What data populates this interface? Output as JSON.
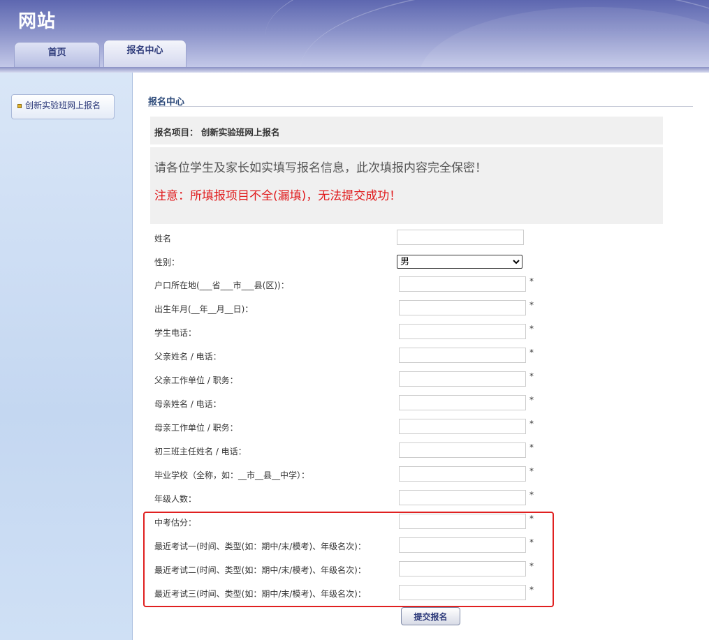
{
  "site": {
    "title": "网站"
  },
  "tabs": [
    {
      "label": "首页"
    },
    {
      "label": "报名中心"
    }
  ],
  "sidebar": {
    "items": [
      {
        "label": "创新实验班网上报名"
      }
    ]
  },
  "main": {
    "section_title": "报名中心",
    "project_label": "报名项目：  创新实验班网上报名",
    "notice_line1": "请各位学生及家长如实填写报名信息，此次填报内容完全保密！",
    "notice_line2": "注意：所填报项目不全(漏填)，无法提交成功！",
    "notice_line2_color": "#e0191b"
  },
  "form": {
    "name_label": "姓名",
    "name_value": "",
    "gender_label": "性别：",
    "gender_selected": "男",
    "required_mark": "*",
    "fields": [
      {
        "label": "户口所在地(___省___市___县(区))：",
        "value": ""
      },
      {
        "label": "出生年月(__年__月__日)：",
        "value": ""
      },
      {
        "label": "学生电话：",
        "value": ""
      },
      {
        "label": "父亲姓名 / 电话：",
        "value": ""
      },
      {
        "label": "父亲工作单位 / 职务：",
        "value": ""
      },
      {
        "label": "母亲姓名 / 电话：",
        "value": ""
      },
      {
        "label": "母亲工作单位 / 职务：",
        "value": ""
      },
      {
        "label": "初三班主任姓名 / 电话：",
        "value": ""
      },
      {
        "label": "毕业学校（全称，如：__市__县__中学）：",
        "value": ""
      },
      {
        "label": "年级人数：",
        "value": ""
      },
      {
        "label": "中考估分：",
        "value": ""
      },
      {
        "label": "最近考试一(时间、类型(如：期中/末/模考)、年级名次)：",
        "value": ""
      },
      {
        "label": "最近考试二(时间、类型(如：期中/末/模考)、年级名次)：",
        "value": ""
      },
      {
        "label": "最近考试三(时间、类型(如：期中/末/模考)、年级名次)：",
        "value": ""
      }
    ],
    "submit_label": "提交报名",
    "highlight_color": "#e02020"
  }
}
